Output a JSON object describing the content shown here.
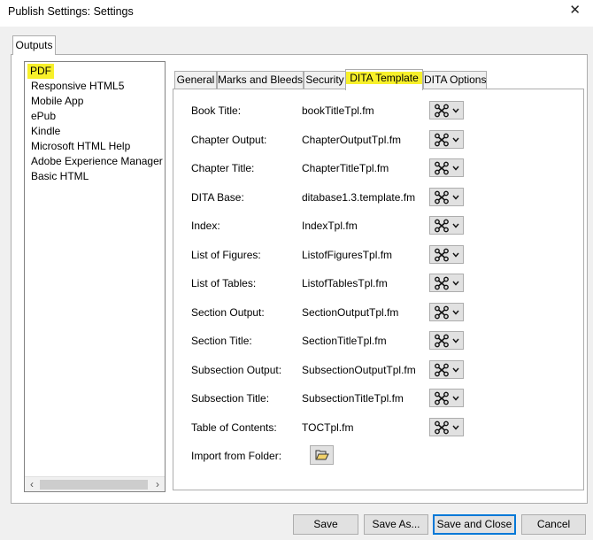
{
  "window": {
    "title": "Publish Settings: Settings",
    "close_glyph": "✕"
  },
  "outer_tab": {
    "label": "Outputs"
  },
  "outputs": {
    "items": [
      {
        "label": "PDF",
        "selected": true
      },
      {
        "label": "Responsive HTML5"
      },
      {
        "label": "Mobile App"
      },
      {
        "label": "ePub"
      },
      {
        "label": "Kindle"
      },
      {
        "label": "Microsoft HTML Help"
      },
      {
        "label": "Adobe Experience Manager Mo"
      },
      {
        "label": "Basic HTML"
      }
    ],
    "scroll_left": "‹",
    "scroll_right": "›"
  },
  "tabs": [
    {
      "label": "General"
    },
    {
      "label": "Marks and Bleeds"
    },
    {
      "label": "Security"
    },
    {
      "label": "DITA Template",
      "active": true
    },
    {
      "label": "DITA Options"
    }
  ],
  "fields": [
    {
      "label": "Book Title:",
      "value": "bookTitleTpl.fm"
    },
    {
      "label": "Chapter Output:",
      "value": "ChapterOutputTpl.fm"
    },
    {
      "label": "Chapter Title:",
      "value": "ChapterTitleTpl.fm"
    },
    {
      "label": "DITA Base:",
      "value": "ditabase1.3.template.fm"
    },
    {
      "label": "Index:",
      "value": "IndexTpl.fm"
    },
    {
      "label": "List of Figures:",
      "value": "ListofFiguresTpl.fm"
    },
    {
      "label": "List of Tables:",
      "value": "ListofTablesTpl.fm"
    },
    {
      "label": "Section Output:",
      "value": "SectionOutputTpl.fm"
    },
    {
      "label": "Section Title:",
      "value": "SectionTitleTpl.fm"
    },
    {
      "label": "Subsection Output:",
      "value": "SubsectionOutputTpl.fm"
    },
    {
      "label": "Subsection Title:",
      "value": "SubsectionTitleTpl.fm"
    },
    {
      "label": "Table of Contents:",
      "value": "TOCTpl.fm"
    }
  ],
  "import_folder": {
    "label": "Import from Folder:"
  },
  "field_button_icons": {
    "primary": "tools-icon",
    "secondary": "chevron-down-icon"
  },
  "buttons": {
    "save": "Save",
    "save_as": "Save As...",
    "save_and_close": "Save and Close",
    "cancel": "Cancel"
  },
  "colors": {
    "highlight": "#f7f02a",
    "default_button_border": "#0078d7"
  }
}
